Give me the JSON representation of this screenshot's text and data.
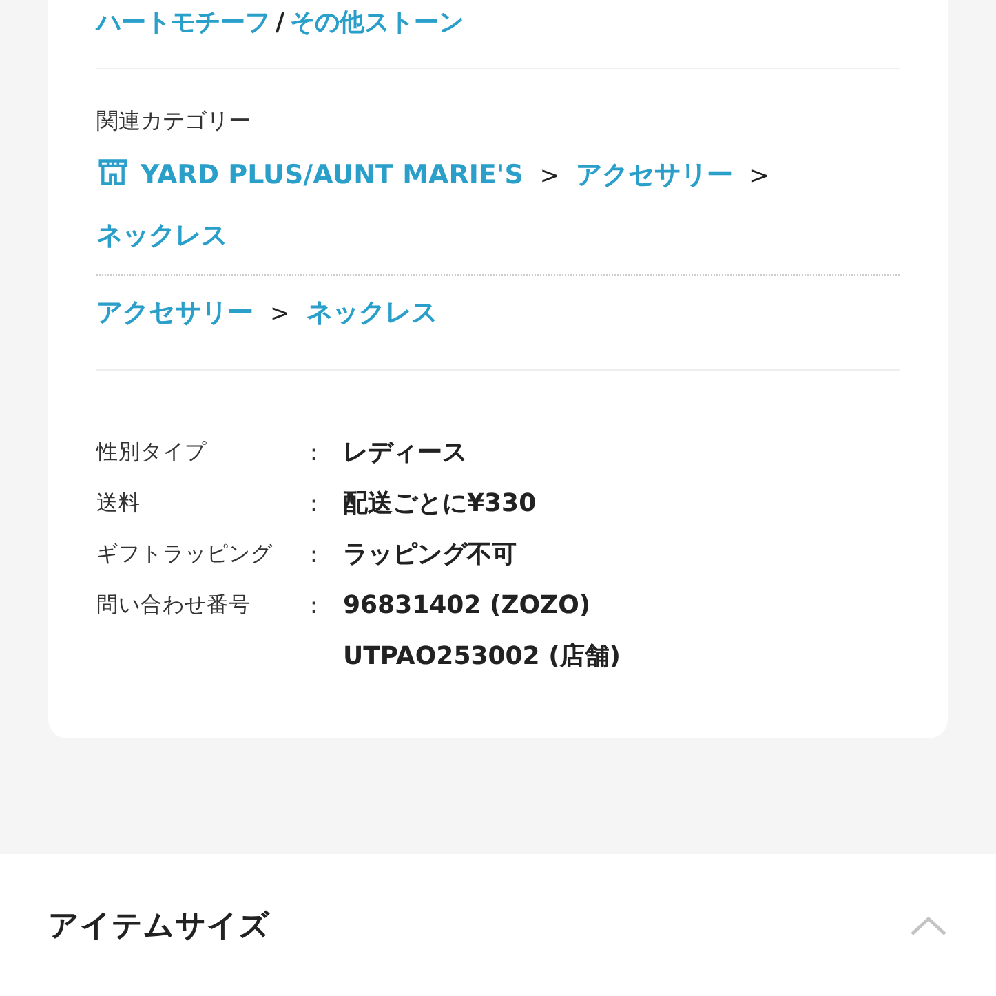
{
  "tags": [
    {
      "kind": "link",
      "text": "ハートモチーフ"
    },
    {
      "kind": "separator",
      "text": "/"
    },
    {
      "kind": "link",
      "text": "その他ストーン"
    }
  ],
  "related_categories": {
    "label": "関連カテゴリー",
    "paths": [
      {
        "kind": "shop",
        "parts": [
          {
            "kind": "link",
            "text": "YARD PLUS/AUNT MARIE'S"
          },
          {
            "kind": "separator",
            "text": ">"
          },
          {
            "kind": "link",
            "text": "アクセサリー"
          },
          {
            "kind": "separator",
            "text": ">"
          },
          {
            "kind": "link",
            "text": "ネックレス"
          }
        ]
      },
      {
        "kind": "category",
        "parts": [
          {
            "kind": "link",
            "text": "アクセサリー"
          },
          {
            "kind": "separator",
            "text": ">"
          },
          {
            "kind": "link",
            "text": "ネックレス"
          }
        ]
      }
    ]
  },
  "specs": [
    {
      "label": "性別タイプ",
      "colon": ":",
      "values": [
        "レディース"
      ]
    },
    {
      "label": "送料",
      "colon": ":",
      "values": [
        "配送ごとに¥330"
      ]
    },
    {
      "label": "ギフトラッピング",
      "colon": ":",
      "values": [
        "ラッピング不可"
      ]
    },
    {
      "label": "問い合わせ番号",
      "colon": ":",
      "values": [
        "96831402 (ZOZO)",
        "UTPAO253002 (店舗)"
      ]
    }
  ],
  "item_size": {
    "title": "アイテムサイズ",
    "expanded": true
  }
}
